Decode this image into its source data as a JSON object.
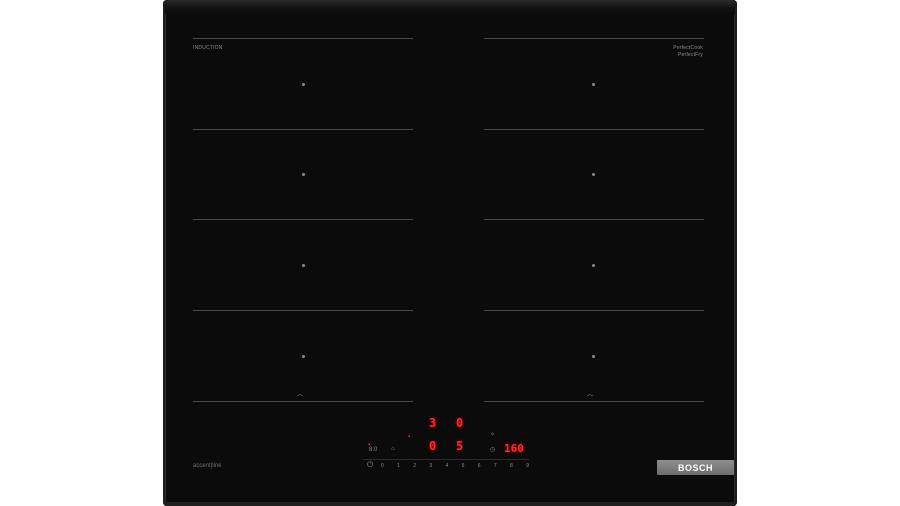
{
  "product": {
    "type_label": "INDUCTION",
    "model_line": "accent|line",
    "brand": "BOSCH",
    "corner_logo": "PerfectCook PerfectFry"
  },
  "display": {
    "top_left_digit": "3",
    "top_right_digit": "0",
    "mid_left_digit": "0",
    "mid_right_digit": "5",
    "timer_value": "160",
    "timer_icon_label": "8:0"
  },
  "slider": {
    "scale": [
      "0",
      "1",
      "2",
      "3",
      "4",
      "5",
      "6",
      "7",
      "8",
      "9"
    ]
  },
  "colors": {
    "glass": "#0b0b0b",
    "display_red": "#ff2a2a",
    "badge_gray": "#7a7a7a"
  }
}
